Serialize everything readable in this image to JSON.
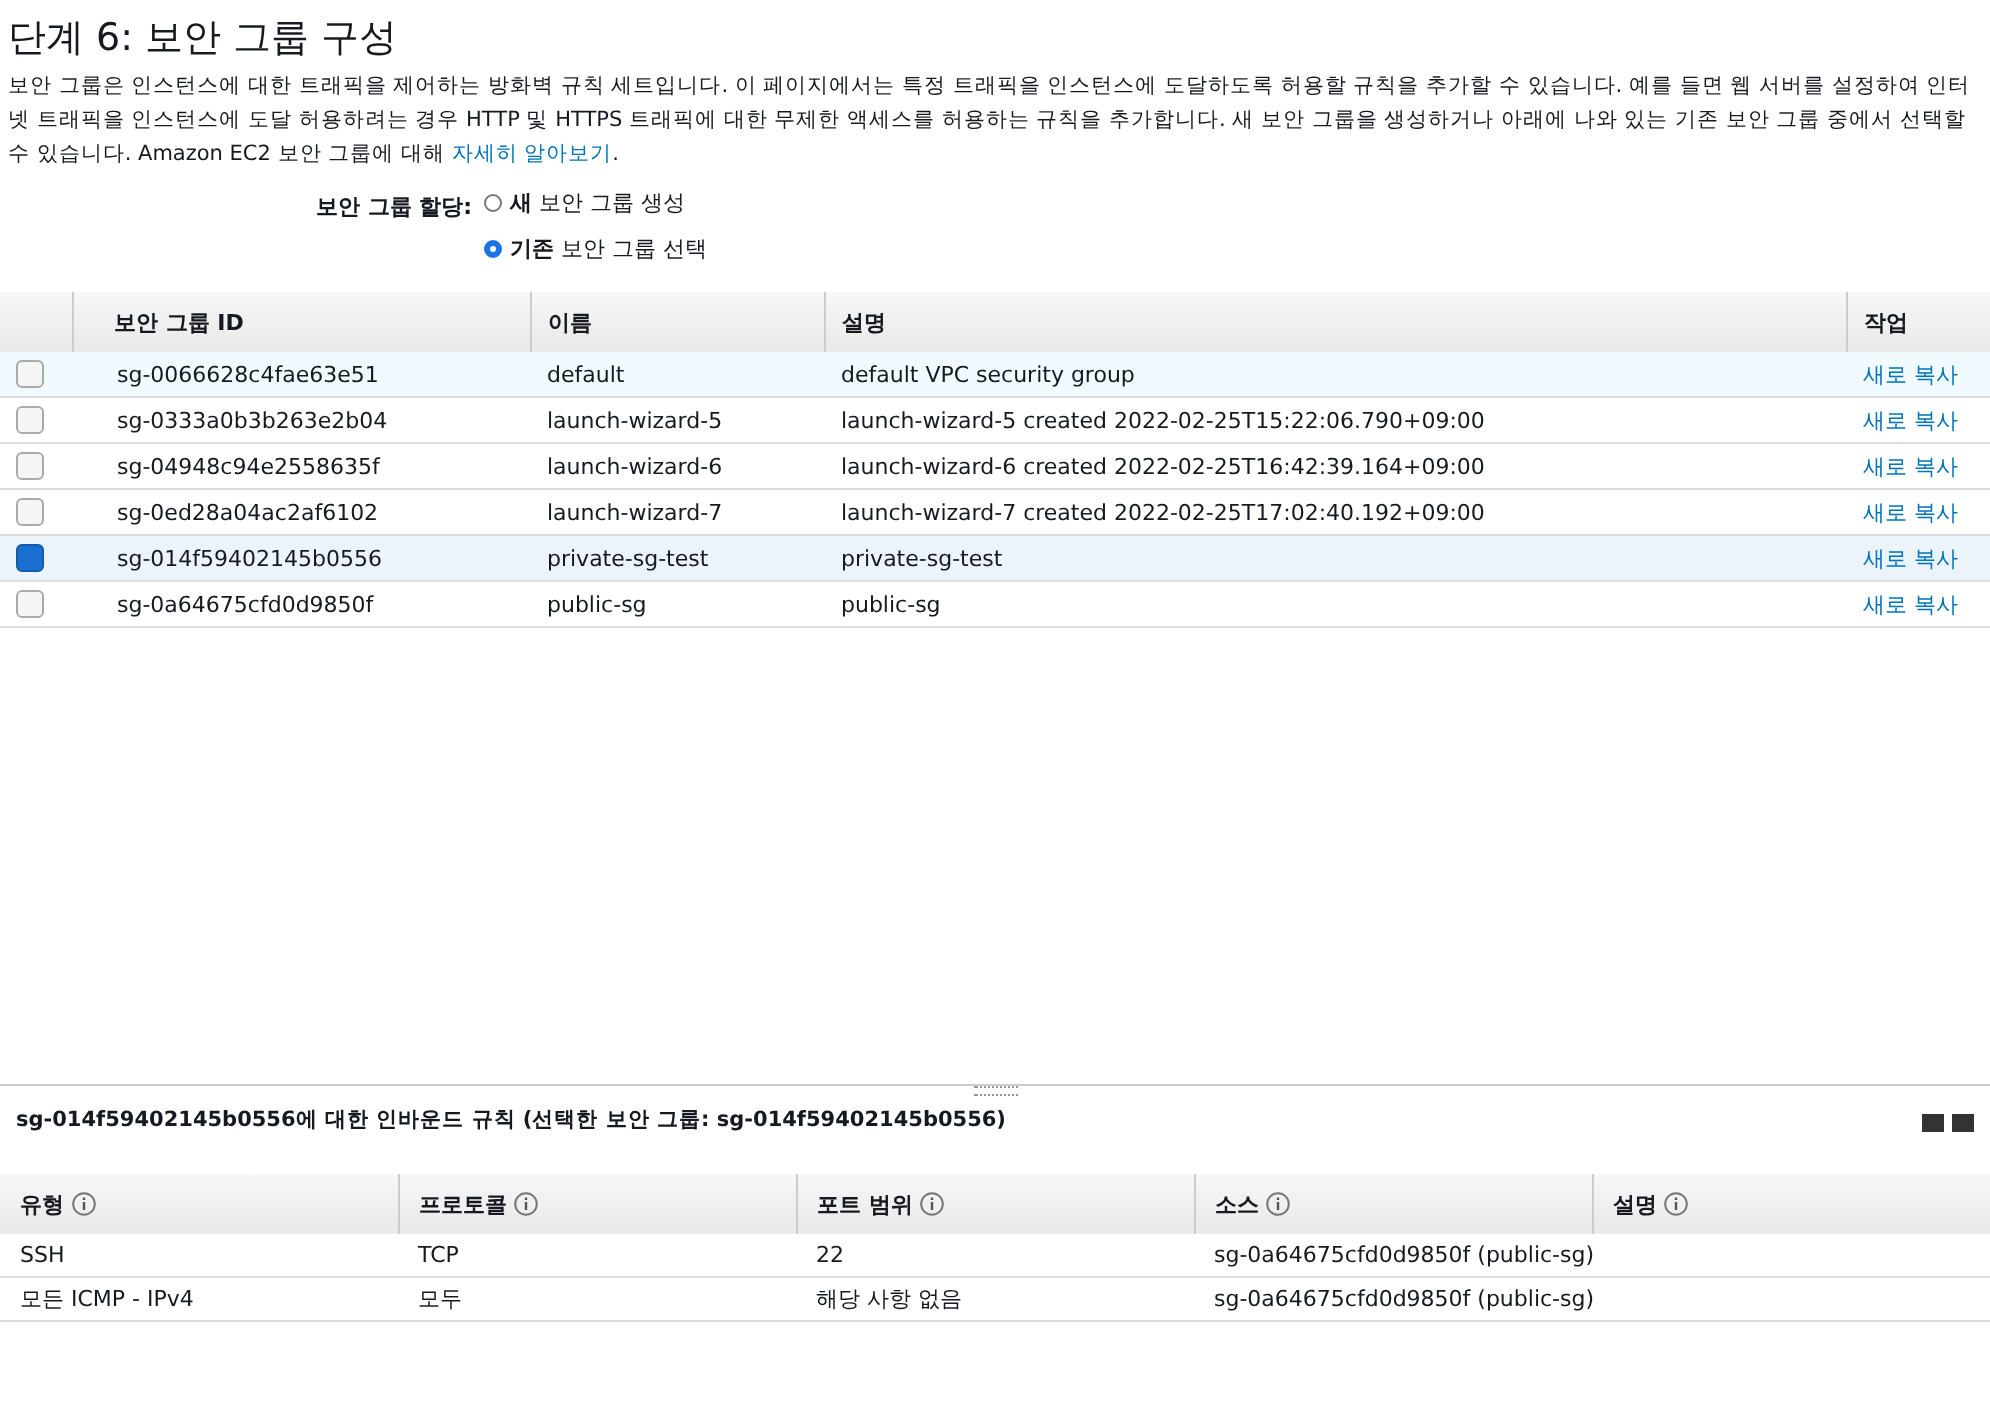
{
  "title": "단계 6: 보안 그룹 구성",
  "description": {
    "text": "보안 그룹은 인스턴스에 대한 트래픽을 제어하는 방화벽 규칙 세트입니다. 이 페이지에서는 특정 트래픽을 인스턴스에 도달하도록 허용할 규칙을 추가할 수 있습니다. 예를 들면 웹 서버를 설정하여 인터넷 트래픽을 인스턴스에 도달 허용하려는 경우 HTTP 및 HTTPS 트래픽에 대한 무제한 액세스를 허용하는 규칙을 추가합니다. 새 보안 그룹을 생성하거나 아래에 나와 있는 기존 보안 그룹 중에서 선택할 수 있습니다. Amazon EC2 보안 그룹에 대해",
    "link": "자세히 알아보기",
    "tail": "."
  },
  "assign": {
    "label": "보안 그룹 할당:",
    "options": [
      {
        "bold": "새",
        "text": "보안 그룹 생성",
        "selected": false
      },
      {
        "bold": "기존",
        "text": "보안 그룹 선택",
        "selected": true
      }
    ]
  },
  "groups": {
    "columns": [
      "보안 그룹 ID",
      "이름",
      "설명",
      "작업"
    ],
    "rows": [
      {
        "id": "sg-0066628c4fae63e51",
        "name": "default",
        "desc": "default VPC security group",
        "action": "새로 복사",
        "selected": false,
        "hover": true
      },
      {
        "id": "sg-0333a0b3b263e2b04",
        "name": "launch-wizard-5",
        "desc": "launch-wizard-5 created 2022-02-25T15:22:06.790+09:00",
        "action": "새로 복사",
        "selected": false,
        "hover": false
      },
      {
        "id": "sg-04948c94e2558635f",
        "name": "launch-wizard-6",
        "desc": "launch-wizard-6 created 2022-02-25T16:42:39.164+09:00",
        "action": "새로 복사",
        "selected": false,
        "hover": false
      },
      {
        "id": "sg-0ed28a04ac2af6102",
        "name": "launch-wizard-7",
        "desc": "launch-wizard-7 created 2022-02-25T17:02:40.192+09:00",
        "action": "새로 복사",
        "selected": false,
        "hover": false
      },
      {
        "id": "sg-014f59402145b0556",
        "name": "private-sg-test",
        "desc": "private-sg-test",
        "action": "새로 복사",
        "selected": true,
        "hover": false
      },
      {
        "id": "sg-0a64675cfd0d9850f",
        "name": "public-sg",
        "desc": "public-sg",
        "action": "새로 복사",
        "selected": false,
        "hover": false
      }
    ]
  },
  "inbound": {
    "title": "sg-014f59402145b0556에 대한 인바운드 규칙 (선택한 보안 그룹: sg-014f59402145b0556)",
    "columns": [
      "유형",
      "프로토콜",
      "포트 범위",
      "소스",
      "설명"
    ],
    "rows": [
      [
        "SSH",
        "TCP",
        "22",
        "sg-0a64675cfd0d9850f (public-sg)",
        ""
      ],
      [
        "모든 ICMP - IPv4",
        "모두",
        "해당 사항 없음",
        "sg-0a64675cfd0d9850f (public-sg)",
        ""
      ]
    ]
  }
}
